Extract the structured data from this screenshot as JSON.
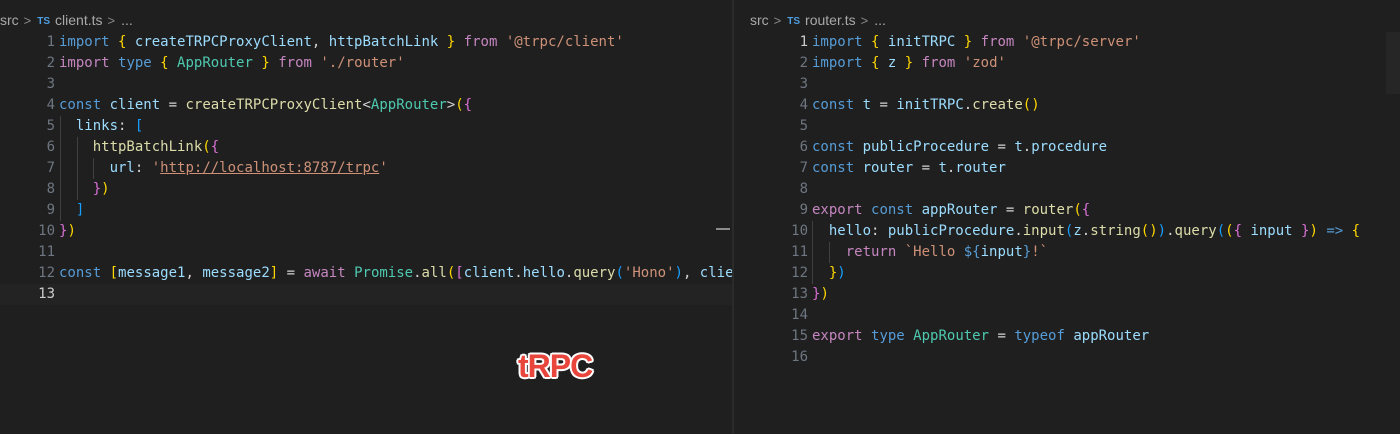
{
  "left": {
    "breadcrumb": {
      "folder": "src",
      "file_icon": "TS",
      "file": "client.ts",
      "more": "..."
    },
    "lines": [
      {
        "n": "1",
        "tokens": [
          [
            "kw",
            "import"
          ],
          [
            "pl",
            " "
          ],
          [
            "b1",
            "{"
          ],
          [
            "pl",
            " "
          ],
          [
            "var",
            "createTRPCProxyClient"
          ],
          [
            "pl",
            ", "
          ],
          [
            "var",
            "httpBatchLink"
          ],
          [
            "pl",
            " "
          ],
          [
            "b1",
            "}"
          ],
          [
            "pl",
            " "
          ],
          [
            "ctl",
            "from"
          ],
          [
            "pl",
            " "
          ],
          [
            "str",
            "'@trpc/client'"
          ]
        ]
      },
      {
        "n": "2",
        "tokens": [
          [
            "ctl",
            "import"
          ],
          [
            "pl",
            " "
          ],
          [
            "kw",
            "type"
          ],
          [
            "pl",
            " "
          ],
          [
            "b1",
            "{"
          ],
          [
            "pl",
            " "
          ],
          [
            "type",
            "AppRouter"
          ],
          [
            "pl",
            " "
          ],
          [
            "b1",
            "}"
          ],
          [
            "pl",
            " "
          ],
          [
            "ctl",
            "from"
          ],
          [
            "pl",
            " "
          ],
          [
            "str",
            "'./router'"
          ]
        ]
      },
      {
        "n": "3",
        "tokens": []
      },
      {
        "n": "4",
        "tokens": [
          [
            "kw",
            "const"
          ],
          [
            "pl",
            " "
          ],
          [
            "var",
            "client"
          ],
          [
            "pl",
            " = "
          ],
          [
            "fn",
            "createTRPCProxyClient"
          ],
          [
            "pl",
            "<"
          ],
          [
            "type",
            "AppRouter"
          ],
          [
            "pl",
            ">"
          ],
          [
            "b1",
            "("
          ],
          [
            "b2",
            "{"
          ]
        ]
      },
      {
        "n": "5",
        "tokens": [
          [
            "pl",
            "  "
          ],
          [
            "var",
            "links"
          ],
          [
            "pl",
            ": "
          ],
          [
            "b3",
            "["
          ]
        ]
      },
      {
        "n": "6",
        "tokens": [
          [
            "pl",
            "    "
          ],
          [
            "fn",
            "httpBatchLink"
          ],
          [
            "b1",
            "("
          ],
          [
            "b2",
            "{"
          ]
        ]
      },
      {
        "n": "7",
        "tokens": [
          [
            "pl",
            "      "
          ],
          [
            "var",
            "url"
          ],
          [
            "pl",
            ": "
          ],
          [
            "str",
            "'"
          ],
          [
            "link",
            "http://localhost:8787/trpc"
          ],
          [
            "str",
            "'"
          ]
        ]
      },
      {
        "n": "8",
        "tokens": [
          [
            "pl",
            "    "
          ],
          [
            "b2",
            "}"
          ],
          [
            "b1",
            ")"
          ]
        ]
      },
      {
        "n": "9",
        "tokens": [
          [
            "pl",
            "  "
          ],
          [
            "b3",
            "]"
          ]
        ]
      },
      {
        "n": "10",
        "tokens": [
          [
            "b2",
            "}"
          ],
          [
            "b1",
            ")"
          ]
        ]
      },
      {
        "n": "11",
        "tokens": []
      },
      {
        "n": "12",
        "tokens": [
          [
            "kw",
            "const"
          ],
          [
            "pl",
            " "
          ],
          [
            "b1",
            "["
          ],
          [
            "var",
            "message1"
          ],
          [
            "pl",
            ", "
          ],
          [
            "var",
            "message2"
          ],
          [
            "b1",
            "]"
          ],
          [
            "pl",
            " = "
          ],
          [
            "ctl",
            "await"
          ],
          [
            "pl",
            " "
          ],
          [
            "type",
            "Promise"
          ],
          [
            "pl",
            "."
          ],
          [
            "fn",
            "all"
          ],
          [
            "b1",
            "("
          ],
          [
            "b2",
            "["
          ],
          [
            "var",
            "client"
          ],
          [
            "pl",
            "."
          ],
          [
            "var",
            "hello"
          ],
          [
            "pl",
            "."
          ],
          [
            "fn",
            "query"
          ],
          [
            "b3",
            "("
          ],
          [
            "str",
            "'Hono'"
          ],
          [
            "b3",
            ")"
          ],
          [
            "pl",
            ", "
          ],
          [
            "var",
            "client"
          ]
        ]
      },
      {
        "n": "13",
        "tokens": []
      }
    ],
    "active_line": "13"
  },
  "right": {
    "breadcrumb": {
      "folder": "src",
      "file_icon": "TS",
      "file": "router.ts",
      "more": "..."
    },
    "lines": [
      {
        "n": "1",
        "tokens": [
          [
            "kw",
            "import"
          ],
          [
            "pl",
            " "
          ],
          [
            "b1",
            "{"
          ],
          [
            "pl",
            " "
          ],
          [
            "var",
            "initTRPC"
          ],
          [
            "pl",
            " "
          ],
          [
            "b1",
            "}"
          ],
          [
            "pl",
            " "
          ],
          [
            "ctl",
            "from"
          ],
          [
            "pl",
            " "
          ],
          [
            "str",
            "'@trpc/server'"
          ]
        ]
      },
      {
        "n": "2",
        "tokens": [
          [
            "kw",
            "import"
          ],
          [
            "pl",
            " "
          ],
          [
            "b1",
            "{"
          ],
          [
            "pl",
            " "
          ],
          [
            "var",
            "z"
          ],
          [
            "pl",
            " "
          ],
          [
            "b1",
            "}"
          ],
          [
            "pl",
            " "
          ],
          [
            "ctl",
            "from"
          ],
          [
            "pl",
            " "
          ],
          [
            "str",
            "'zod'"
          ]
        ]
      },
      {
        "n": "3",
        "tokens": []
      },
      {
        "n": "4",
        "tokens": [
          [
            "kw",
            "const"
          ],
          [
            "pl",
            " "
          ],
          [
            "var",
            "t"
          ],
          [
            "pl",
            " = "
          ],
          [
            "var",
            "initTRPC"
          ],
          [
            "pl",
            "."
          ],
          [
            "fn",
            "create"
          ],
          [
            "b1",
            "()"
          ]
        ]
      },
      {
        "n": "5",
        "tokens": []
      },
      {
        "n": "6",
        "tokens": [
          [
            "kw",
            "const"
          ],
          [
            "pl",
            " "
          ],
          [
            "var",
            "publicProcedure"
          ],
          [
            "pl",
            " = "
          ],
          [
            "var",
            "t"
          ],
          [
            "pl",
            "."
          ],
          [
            "var",
            "procedure"
          ]
        ]
      },
      {
        "n": "7",
        "tokens": [
          [
            "kw",
            "const"
          ],
          [
            "pl",
            " "
          ],
          [
            "var",
            "router"
          ],
          [
            "pl",
            " = "
          ],
          [
            "var",
            "t"
          ],
          [
            "pl",
            "."
          ],
          [
            "var",
            "router"
          ]
        ]
      },
      {
        "n": "8",
        "tokens": []
      },
      {
        "n": "9",
        "tokens": [
          [
            "ctl",
            "export"
          ],
          [
            "pl",
            " "
          ],
          [
            "kw",
            "const"
          ],
          [
            "pl",
            " "
          ],
          [
            "var",
            "appRouter"
          ],
          [
            "pl",
            " = "
          ],
          [
            "fn",
            "router"
          ],
          [
            "b1",
            "("
          ],
          [
            "b2",
            "{"
          ]
        ]
      },
      {
        "n": "10",
        "tokens": [
          [
            "pl",
            "  "
          ],
          [
            "var",
            "hello"
          ],
          [
            "pl",
            ": "
          ],
          [
            "var",
            "publicProcedure"
          ],
          [
            "pl",
            "."
          ],
          [
            "fn",
            "input"
          ],
          [
            "b3",
            "("
          ],
          [
            "var",
            "z"
          ],
          [
            "pl",
            "."
          ],
          [
            "fn",
            "string"
          ],
          [
            "b1",
            "()"
          ],
          [
            "b3",
            ")"
          ],
          [
            "pl",
            "."
          ],
          [
            "fn",
            "query"
          ],
          [
            "b3",
            "("
          ],
          [
            "b1",
            "("
          ],
          [
            "b2",
            "{"
          ],
          [
            "pl",
            " "
          ],
          [
            "var",
            "input"
          ],
          [
            "pl",
            " "
          ],
          [
            "b2",
            "}"
          ],
          [
            "b1",
            ")"
          ],
          [
            "pl",
            " "
          ],
          [
            "kw",
            "=>"
          ],
          [
            "pl",
            " "
          ],
          [
            "b1",
            "{"
          ]
        ]
      },
      {
        "n": "11",
        "tokens": [
          [
            "pl",
            "    "
          ],
          [
            "ctl",
            "return"
          ],
          [
            "pl",
            " "
          ],
          [
            "str",
            "`Hello "
          ],
          [
            "kw",
            "${"
          ],
          [
            "var",
            "input"
          ],
          [
            "kw",
            "}"
          ],
          [
            "str",
            "!`"
          ]
        ]
      },
      {
        "n": "12",
        "tokens": [
          [
            "pl",
            "  "
          ],
          [
            "b1",
            "}"
          ],
          [
            "b3",
            ")"
          ]
        ]
      },
      {
        "n": "13",
        "tokens": [
          [
            "b2",
            "}"
          ],
          [
            "b1",
            ")"
          ]
        ]
      },
      {
        "n": "14",
        "tokens": []
      },
      {
        "n": "15",
        "tokens": [
          [
            "ctl",
            "export"
          ],
          [
            "pl",
            " "
          ],
          [
            "kw",
            "type"
          ],
          [
            "pl",
            " "
          ],
          [
            "type",
            "AppRouter"
          ],
          [
            "pl",
            " = "
          ],
          [
            "kw",
            "typeof"
          ],
          [
            "pl",
            " "
          ],
          [
            "var",
            "appRouter"
          ]
        ]
      },
      {
        "n": "16",
        "tokens": []
      }
    ],
    "active_line": "1"
  },
  "overlay": {
    "logo_text": "tRPC",
    "logo_color": "#e8453c"
  }
}
